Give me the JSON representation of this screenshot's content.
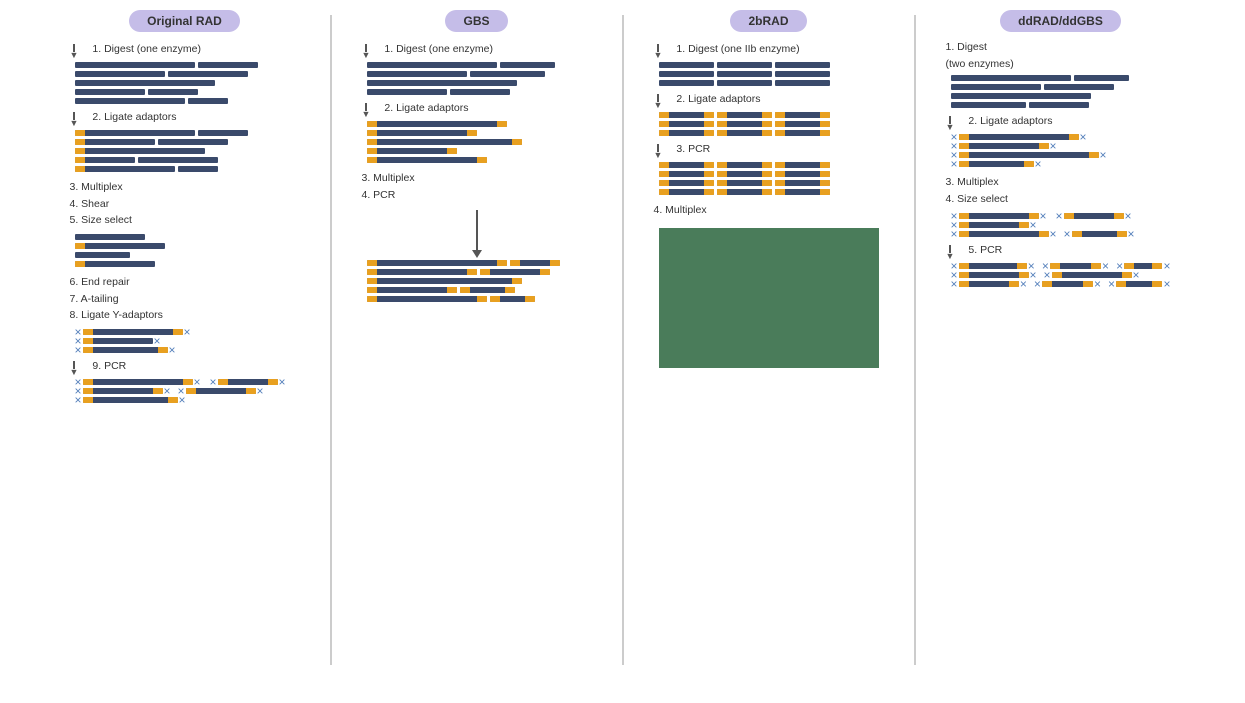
{
  "columns": [
    {
      "id": "original-rad",
      "title": "Original RAD",
      "steps": [
        {
          "label": "↓ 1. Digest (one enzyme)",
          "type": "arrow-label"
        },
        {
          "type": "plain-dna-varied"
        },
        {
          "label": "↓ 2. Ligate adaptors",
          "type": "arrow-label"
        },
        {
          "type": "orange-left-dna"
        },
        {
          "label": "3. Multiplex\n4. Shear\n5. Size select",
          "type": "step-only"
        },
        {
          "type": "sheared-dna"
        },
        {
          "label": "6. End repair\n7. A-tailing\n8. Ligate Y-adaptors",
          "type": "step-only"
        },
        {
          "type": "y-adaptor-dna"
        },
        {
          "label": "↓ 9. PCR",
          "type": "arrow-label"
        },
        {
          "type": "final-pcr-dna"
        }
      ]
    },
    {
      "id": "gbs",
      "title": "GBS",
      "steps": [
        {
          "label": "↓ 1. Digest (one enzyme)",
          "type": "arrow-label"
        },
        {
          "type": "plain-dna-varied"
        },
        {
          "label": "↓ 2. Ligate adaptors",
          "type": "arrow-label"
        },
        {
          "type": "orange-both-dna-long"
        },
        {
          "label": "3. Multiplex\n4. PCR",
          "type": "step-only"
        },
        {
          "type": "final-both-dna-many"
        }
      ]
    },
    {
      "id": "2brad",
      "title": "2bRAD",
      "steps": [
        {
          "label": "↓ 1. Digest (one IIb enzyme)",
          "type": "arrow-label"
        },
        {
          "type": "short-dna-pairs"
        },
        {
          "label": "↓ 2. Ligate adaptors",
          "type": "arrow-label"
        },
        {
          "type": "orange-both-short"
        },
        {
          "label": "↓ 3. PCR",
          "type": "arrow-label"
        },
        {
          "type": "final-both-short-many"
        },
        {
          "label": "4. Multiplex",
          "type": "step-only"
        },
        {
          "type": "green-block"
        }
      ]
    },
    {
      "id": "ddrad-ddgbs",
      "title": "ddRAD/ddGBS",
      "steps": [
        {
          "label": "1. Digest\n(two enzymes)",
          "type": "step-only"
        },
        {
          "type": "plain-dna-varied"
        },
        {
          "label": "↓ 2. Ligate adaptors",
          "type": "arrow-label"
        },
        {
          "type": "cross-adaptor-dna"
        },
        {
          "label": "3. Multiplex\n4. Size select",
          "type": "step-only"
        },
        {
          "type": "cross-adaptor-dna-short"
        },
        {
          "label": "↓ 5. PCR",
          "type": "arrow-label"
        },
        {
          "type": "final-cross-many"
        }
      ]
    }
  ]
}
